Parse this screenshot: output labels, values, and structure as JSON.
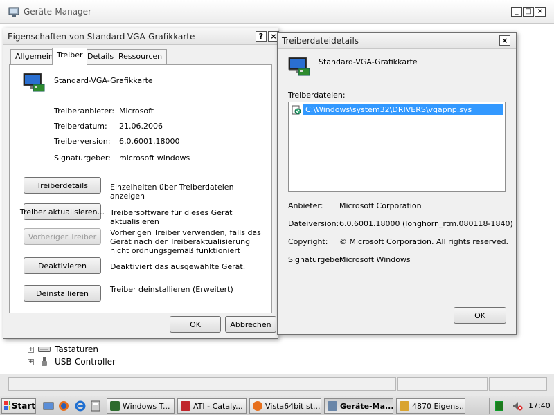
{
  "device_manager": {
    "title": "Geräte-Manager",
    "tree_items": [
      {
        "label": "Tastaturen",
        "icon": "keyboard-icon"
      },
      {
        "label": "USB-Controller",
        "icon": "usb-icon"
      }
    ],
    "window_controls": {
      "minimize": "_",
      "maximize": "□",
      "close": "×"
    }
  },
  "properties_dialog": {
    "title": "Eigenschaften von Standard-VGA-Grafikkarte",
    "help_label": "?",
    "close_label": "×",
    "tabs": [
      {
        "label": "Allgemein"
      },
      {
        "label": "Treiber"
      },
      {
        "label": "Details"
      },
      {
        "label": "Ressourcen"
      }
    ],
    "active_tab": "Treiber",
    "device_name": "Standard-VGA-Grafikkarte",
    "info": [
      {
        "label": "Treiberanbieter:",
        "value": "Microsoft"
      },
      {
        "label": "Treiberdatum:",
        "value": "21.06.2006"
      },
      {
        "label": "Treiberversion:",
        "value": "6.0.6001.18000"
      },
      {
        "label": "Signaturgeber:",
        "value": "microsoft windows"
      }
    ],
    "actions": [
      {
        "button": "Treiberdetails",
        "description": "Einzelheiten über Treiberdateien anzeigen",
        "enabled": true
      },
      {
        "button": "Treiber aktualisieren...",
        "description": "Treibersoftware für dieses Gerät aktualisieren",
        "enabled": true
      },
      {
        "button": "Vorheriger Treiber",
        "description": "Vorherigen Treiber verwenden, falls das Gerät nach der Treiberaktualisierung nicht ordnungsgemäß funktioniert",
        "enabled": false
      },
      {
        "button": "Deaktivieren",
        "description": "Deaktiviert das ausgewählte Gerät.",
        "enabled": true
      },
      {
        "button": "Deinstallieren",
        "description": "Treiber deinstallieren (Erweitert)",
        "enabled": true
      }
    ],
    "ok_label": "OK",
    "cancel_label": "Abbrechen"
  },
  "details_dialog": {
    "title": "Treiberdateidetails",
    "close_label": "×",
    "device_name": "Standard-VGA-Grafikkarte",
    "files_label": "Treiberdateien:",
    "files": [
      "C:\\Windows\\system32\\DRIVERS\\vgapnp.sys"
    ],
    "info": [
      {
        "label": "Anbieter:",
        "value": "Microsoft Corporation"
      },
      {
        "label": "Dateiversion:",
        "value": "6.0.6001.18000 (longhorn_rtm.080118-1840)"
      },
      {
        "label": "Copyright:",
        "value": "© Microsoft Corporation. All rights reserved."
      },
      {
        "label": "Signaturgeber:",
        "value": "Microsoft Windows"
      }
    ],
    "ok_label": "OK"
  },
  "taskbar": {
    "start_label": "Start",
    "tasks": [
      {
        "label": "Windows T...",
        "icon": "task-manager-icon",
        "active": false
      },
      {
        "label": "ATI - Cataly...",
        "icon": "ati-icon",
        "active": false
      },
      {
        "label": "Vista64bit st...",
        "icon": "firefox-icon",
        "active": false
      },
      {
        "label": "Geräte-Ma...",
        "icon": "device-manager-icon",
        "active": true
      },
      {
        "label": "4870 Eigens...",
        "icon": "display-icon",
        "active": false
      }
    ],
    "clock": "17:40"
  },
  "colors": {
    "selection": "#3399ff",
    "dialog_bg": "#f0f0f0"
  }
}
